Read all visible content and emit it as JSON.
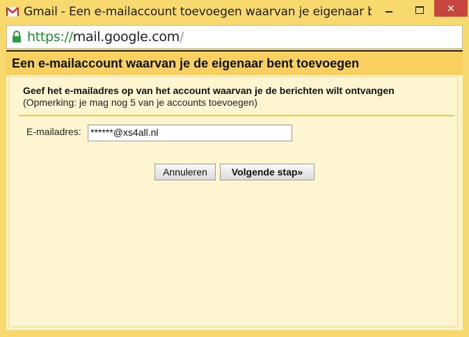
{
  "window": {
    "title": "Gmail - Een e-mailaccount toevoegen waarvan je eigenaar be…",
    "minimize_label": "–",
    "close_label": "✕"
  },
  "address_bar": {
    "scheme": "https://",
    "host": "mail.google.com",
    "path": "/",
    "secure": true
  },
  "dialog": {
    "title": "Een e-mailaccount waarvan je de eigenaar bent toevoegen",
    "lead": "Geef het e-mailadres op van het account waarvan je de berichten wilt ontvangen",
    "note": "(Opmerking: je mag nog 5 van je accounts toevoegen)",
    "email_label": "E-mailadres:",
    "email_value": "******@xs4all.nl",
    "cancel_label": "Annuleren",
    "next_label": "Volgende stap»"
  },
  "colors": {
    "header": "#f8d05f",
    "panel": "#fff5d1",
    "close_button": "#c7463f",
    "https_green": "#1a8c2e"
  }
}
